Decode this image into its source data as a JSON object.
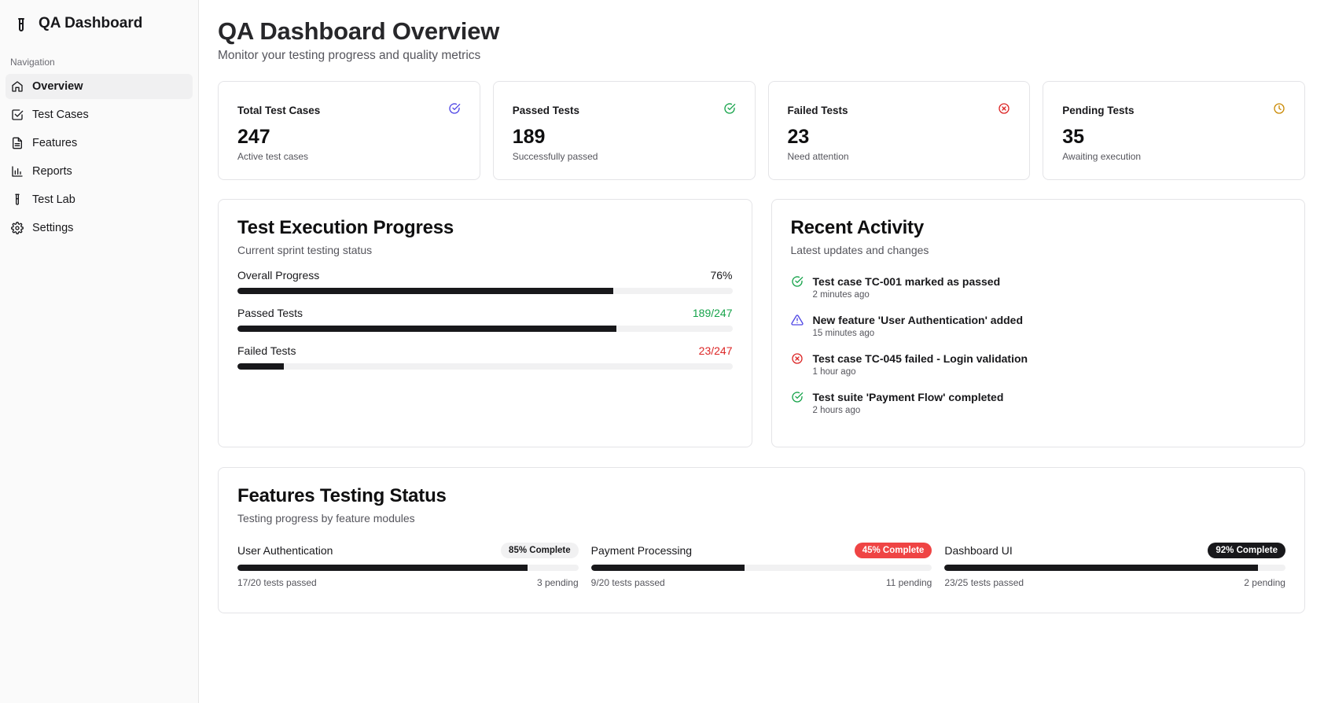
{
  "brand": {
    "title": "QA Dashboard",
    "icon": "test-tube-icon"
  },
  "sidebar": {
    "section_label": "Navigation",
    "items": [
      {
        "label": "Overview",
        "icon": "home-icon",
        "active": true
      },
      {
        "label": "Test Cases",
        "icon": "checkbox-icon",
        "active": false
      },
      {
        "label": "Features",
        "icon": "document-icon",
        "active": false
      },
      {
        "label": "Reports",
        "icon": "bar-chart-icon",
        "active": false
      },
      {
        "label": "Test Lab",
        "icon": "test-tube-icon",
        "active": false
      },
      {
        "label": "Settings",
        "icon": "gear-icon",
        "active": false
      }
    ]
  },
  "header": {
    "title": "QA Dashboard Overview",
    "subtitle": "Monitor your testing progress and quality metrics"
  },
  "stats": [
    {
      "title": "Total Test Cases",
      "value": "247",
      "desc": "Active test cases",
      "icon": "check-circle-icon",
      "color": "#4f46e5"
    },
    {
      "title": "Passed Tests",
      "value": "189",
      "desc": "Successfully passed",
      "icon": "check-circle-icon",
      "color": "#16a34a"
    },
    {
      "title": "Failed Tests",
      "value": "23",
      "desc": "Need attention",
      "icon": "x-circle-icon",
      "color": "#dc2626"
    },
    {
      "title": "Pending Tests",
      "value": "35",
      "desc": "Awaiting execution",
      "icon": "clock-icon",
      "color": "#ca8a04"
    }
  ],
  "execution": {
    "title": "Test Execution Progress",
    "subtitle": "Current sprint testing status",
    "rows": [
      {
        "label": "Overall Progress",
        "value": "76%",
        "fraction": 0.76,
        "tone": "default"
      },
      {
        "label": "Passed Tests",
        "value": "189/247",
        "fraction": 0.765,
        "tone": "green"
      },
      {
        "label": "Failed Tests",
        "value": "23/247",
        "fraction": 0.093,
        "tone": "red"
      }
    ]
  },
  "activity": {
    "title": "Recent Activity",
    "subtitle": "Latest updates and changes",
    "items": [
      {
        "text": "Test case TC-001 marked as passed",
        "time": "2 minutes ago",
        "icon": "check-circle-icon",
        "color": "#16a34a"
      },
      {
        "text": "New feature 'User Authentication' added",
        "time": "15 minutes ago",
        "icon": "warning-triangle-icon",
        "color": "#4f46e5"
      },
      {
        "text": "Test case TC-045 failed - Login validation",
        "time": "1 hour ago",
        "icon": "x-circle-icon",
        "color": "#dc2626"
      },
      {
        "text": "Test suite 'Payment Flow' completed",
        "time": "2 hours ago",
        "icon": "check-circle-icon",
        "color": "#16a34a"
      }
    ]
  },
  "features": {
    "title": "Features Testing Status",
    "subtitle": "Testing progress by feature modules",
    "items": [
      {
        "name": "User Authentication",
        "badge": "85% Complete",
        "badge_style": "neutral",
        "fraction": 0.85,
        "passed": "17/20 tests passed",
        "pending": "3 pending"
      },
      {
        "name": "Payment Processing",
        "badge": "45% Complete",
        "badge_style": "red",
        "fraction": 0.45,
        "passed": "9/20 tests passed",
        "pending": "11 pending"
      },
      {
        "name": "Dashboard UI",
        "badge": "92% Complete",
        "badge_style": "dark",
        "fraction": 0.92,
        "passed": "23/25 tests passed",
        "pending": "2 pending"
      }
    ]
  }
}
